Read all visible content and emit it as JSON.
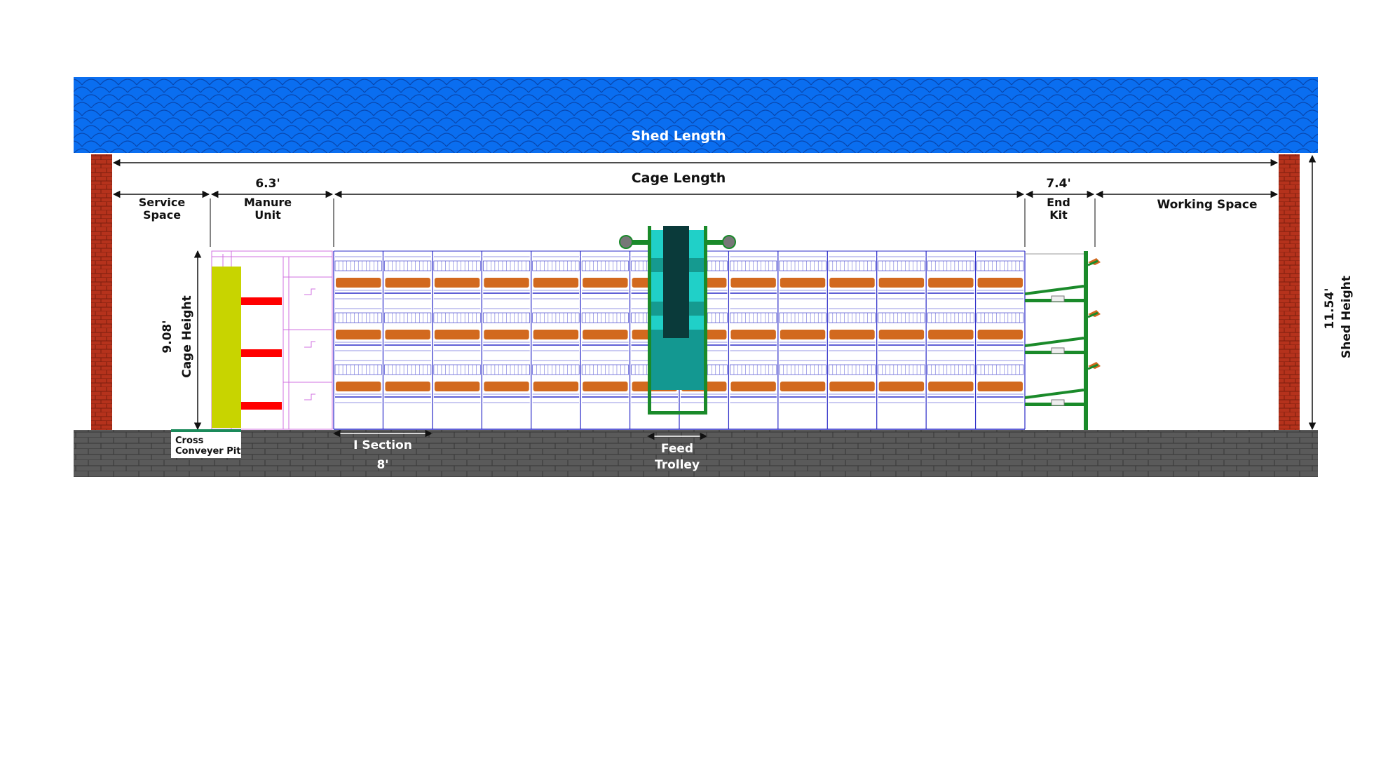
{
  "labels": {
    "shed_length": "Shed Length",
    "cage_length": "Cage Length",
    "service_space": [
      "Service",
      "Space"
    ],
    "manure_unit_dim": "6.3'",
    "manure_unit": [
      "Manure",
      "Unit"
    ],
    "end_kit_dim": "7.4'",
    "end_kit": [
      "End",
      "Kit"
    ],
    "working_space": "Working Space",
    "cage_height_dim": "9.08'",
    "cage_height": "Cage Height",
    "shed_height_dim": "11.54'",
    "shed_height": "Shed Height",
    "cross_conveyer_pit": [
      "Cross",
      "Conveyer Pit"
    ],
    "i_section": "I Section",
    "i_section_dim": "8'",
    "feed_trolley": [
      "Feed",
      "Trolley"
    ]
  },
  "colors": {
    "roof": "#0a6ef0",
    "roof_scale_line": "#0848b0",
    "pillar": "#b5321c",
    "floor": "#5a5a5a",
    "cage_frame": "#2b2bc8",
    "feed_trough": "#d2691e",
    "manure_frame": "#d070e0",
    "manure_block": "#c8d400",
    "manure_belt": "#ff0000",
    "trolley_body": "#20d0c8",
    "trolley_dark": "#0a3a3a",
    "end_kit": "#1a8a2a"
  },
  "layout": {
    "cage_sections": 14,
    "tiers": 3
  }
}
